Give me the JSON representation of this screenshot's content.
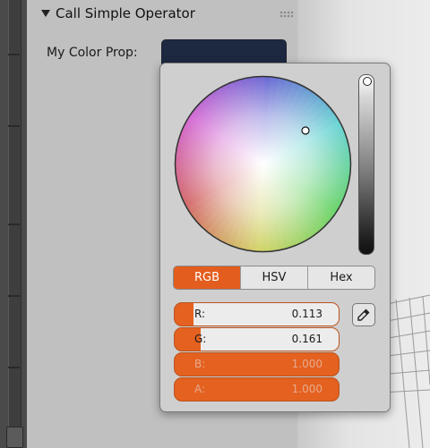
{
  "panel": {
    "title": "Call Simple Operator",
    "prop_label": "My Color Prop:"
  },
  "color": {
    "swatch_hex": "#1d2940",
    "accent": "#e35d1e"
  },
  "picker": {
    "tabs": [
      {
        "label": "RGB",
        "active": true
      },
      {
        "label": "HSV",
        "active": false
      },
      {
        "label": "Hex",
        "active": false
      }
    ],
    "fields": [
      {
        "label": "R:",
        "value": "0.113",
        "fill": 0.113
      },
      {
        "label": "G:",
        "value": "0.161",
        "fill": 0.161
      },
      {
        "label": "B:",
        "value": "1.000",
        "fill": 1.0
      },
      {
        "label": "A:",
        "value": "1.000",
        "fill": 1.0
      }
    ]
  },
  "icons": {
    "collapse": "triangle-down-icon",
    "drag": "grip-icon",
    "eyedropper": "eyedropper-icon"
  }
}
